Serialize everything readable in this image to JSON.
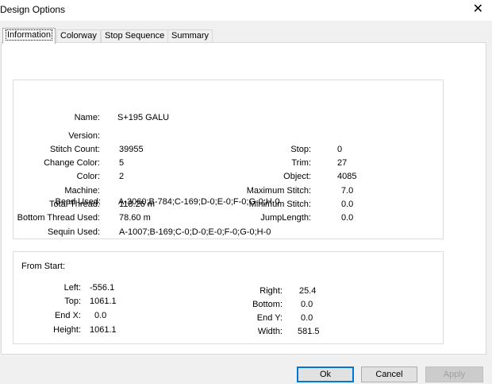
{
  "window": {
    "title": "Design Options"
  },
  "tabs": [
    {
      "label": "Information",
      "active": true
    },
    {
      "label": "Colorway"
    },
    {
      "label": "Stop Sequence"
    },
    {
      "label": "Summary"
    }
  ],
  "info": {
    "name_label": "Name:",
    "name_value": "S+195 GALU",
    "version_label": "Version:",
    "version_value": "",
    "stitch_count_label": "Stitch Count:",
    "stitch_count_value": "39955",
    "change_color_label": "Change Color:",
    "change_color_value": "5",
    "color_label": "Color:",
    "color_value": "2",
    "machine_label": "Machine:",
    "machine_value": "",
    "total_thread_label": "Total Thread:",
    "total_thread_value": "118.26 m",
    "bottom_thread_label": "Bottom Thread Used:",
    "bottom_thread_value": "78.60 m",
    "sequin_label": "Sequin Used:",
    "sequin_value": "A-1007;B-169;C-0;D-0;E-0;F-0;G-0;H-0",
    "bead_label": "Bead Used:",
    "bead_value": "A-3060;B-784;C-169;D-0;E-0;F-0;G-0;H-0",
    "stop_label": "Stop:",
    "stop_value": "0",
    "trim_label": "Trim:",
    "trim_value": "27",
    "object_label": "Object:",
    "object_value": "4085",
    "max_stitch_label": "Maximum Stitch:",
    "max_stitch_value": "7.0",
    "min_stitch_label": "Minimum Stitch:",
    "min_stitch_value": "0.0",
    "jump_length_label": "JumpLength:",
    "jump_length_value": "0.0"
  },
  "from_start": {
    "heading": "From Start:",
    "left_label": "Left:",
    "left_value": "-556.1",
    "top_label": "Top:",
    "top_value": "1061.1",
    "endx_label": "End X:",
    "endx_value": "0.0",
    "height_label": "Height:",
    "height_value": "1061.1",
    "right_label": "Right:",
    "right_value": "25.4",
    "bottom_label": "Bottom:",
    "bottom_value": "0.0",
    "endy_label": "End Y:",
    "endy_value": "0.0",
    "width_label": "Width:",
    "width_value": "581.5"
  },
  "buttons": {
    "ok": "Ok",
    "cancel": "Cancel",
    "apply": "Apply"
  },
  "colors": {
    "accent": "#0078d7",
    "panel": "#ffffff",
    "chrome": "#f0f0f0"
  }
}
